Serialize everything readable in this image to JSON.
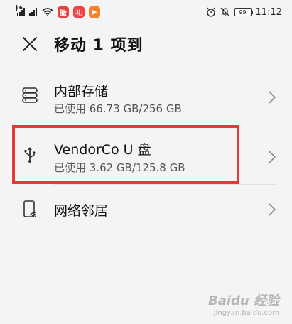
{
  "status_bar": {
    "network_type": "26",
    "time": "11:12",
    "battery": "99",
    "apps": [
      {
        "name": "weibo-icon",
        "glyph": "微",
        "color": "#e64340"
      },
      {
        "name": "gift-icon",
        "glyph": "礼",
        "color": "#f04444"
      },
      {
        "name": "video-icon",
        "glyph": "▶",
        "color": "#f5822a"
      }
    ]
  },
  "header": {
    "title": "移动 1 项到"
  },
  "items": [
    {
      "title": "内部存储",
      "subtitle": "已使用 66.73 GB/256 GB",
      "icon": "storage-icon"
    },
    {
      "title": "VendorCo U 盘",
      "subtitle": "已使用 3.62 GB/125.8 GB",
      "icon": "usb-icon"
    },
    {
      "title": "网络邻居",
      "icon": "network-neighborhood-icon"
    }
  ],
  "colors": {
    "highlight": "#e53935",
    "text_primary": "#111111",
    "text_secondary": "#555555"
  },
  "watermark": {
    "text": "Baidu 经验",
    "url": "jingyan.baidu.com"
  }
}
